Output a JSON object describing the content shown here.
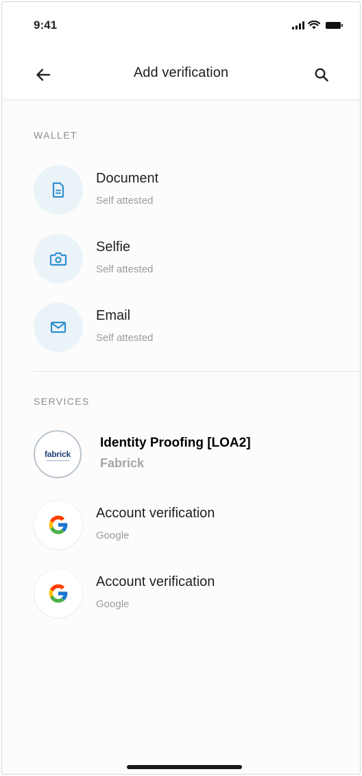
{
  "status_bar": {
    "time": "9:41"
  },
  "header": {
    "title": "Add verification"
  },
  "colors": {
    "accent": "#2f8fcf",
    "icon_bg": "#eaf3f8",
    "muted": "#9b9b9b"
  },
  "wallet": {
    "label": "WALLET",
    "items": [
      {
        "title": "Document",
        "subtitle": "Self attested",
        "icon": "document-icon"
      },
      {
        "title": "Selfie",
        "subtitle": "Self attested",
        "icon": "camera-icon"
      },
      {
        "title": "Email",
        "subtitle": "Self attested",
        "icon": "mail-icon"
      }
    ]
  },
  "services": {
    "label": "SERVICES",
    "items": [
      {
        "title": "Identity Proofing [LOA2]",
        "subtitle": "Fabrick",
        "icon": "fabrick-logo",
        "logo_text": "fabrick"
      },
      {
        "title": "Account verification",
        "subtitle": "Google",
        "icon": "google-icon"
      },
      {
        "title": "Account verification",
        "subtitle": "Google",
        "icon": "google-icon"
      }
    ]
  }
}
